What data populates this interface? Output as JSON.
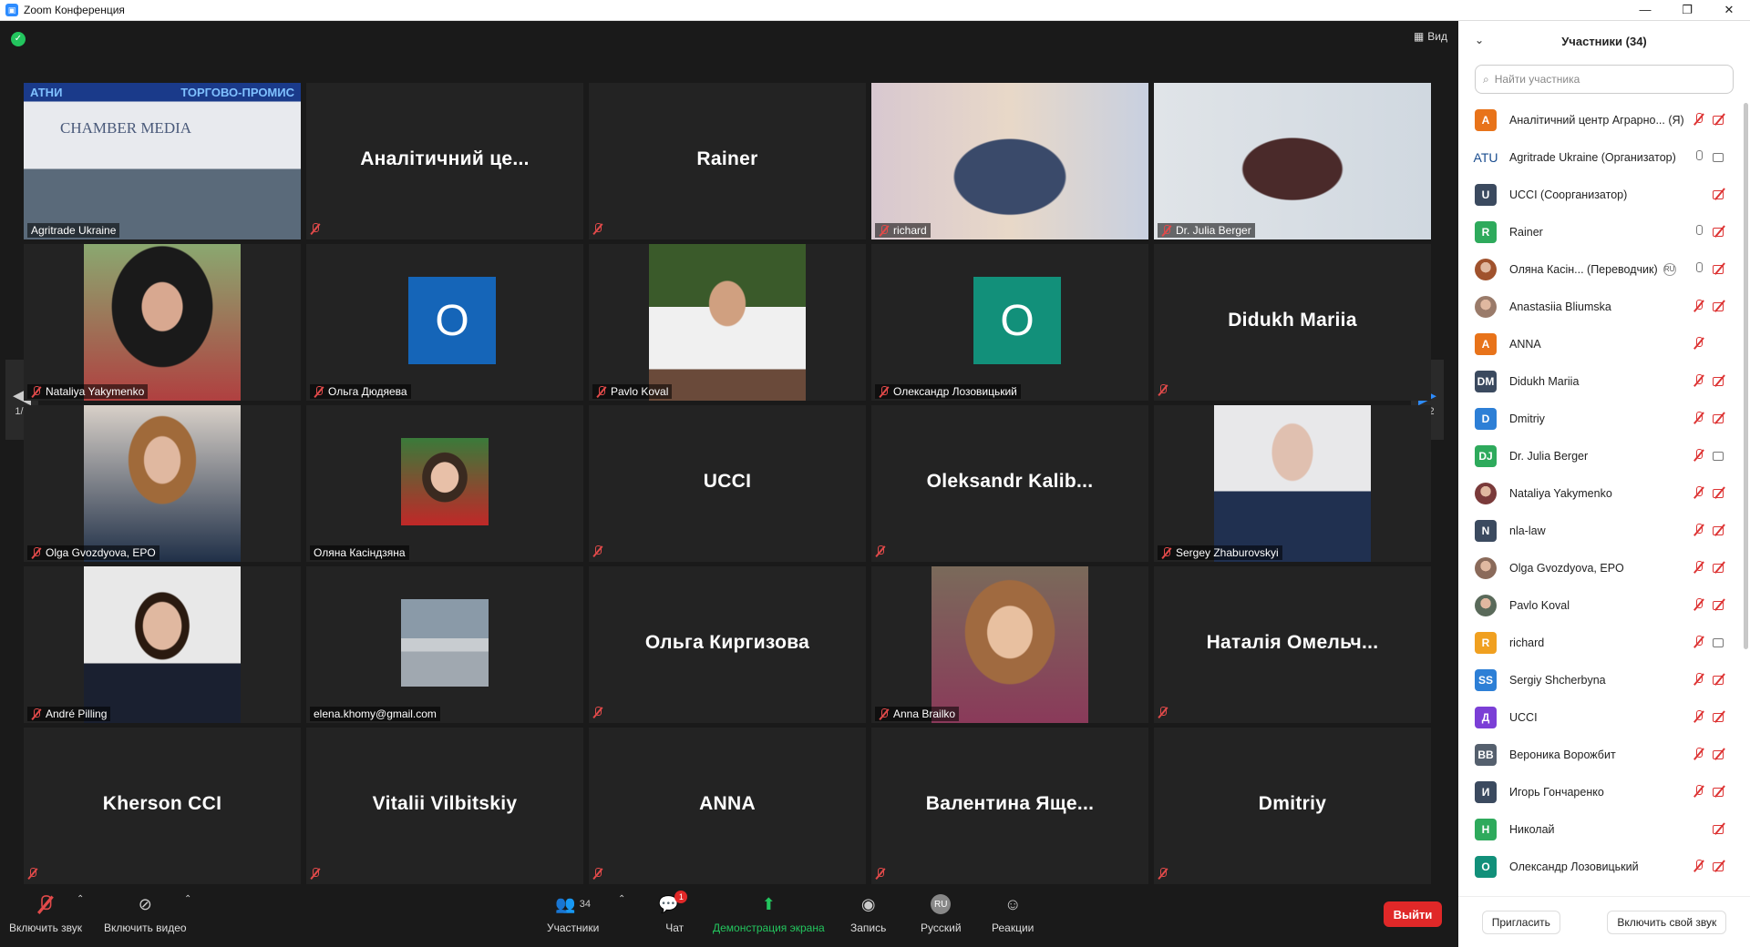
{
  "window": {
    "title": "Zoom Конференция"
  },
  "view": {
    "label": "Вид"
  },
  "tiles": [
    {
      "kind": "photo",
      "label": "Agritrade Ukraine",
      "overlay_text": "ТОРГОВО-ПРОМИС",
      "overlay_text_left": "АТНИ",
      "logo_text": "CHAMBER MEDIA",
      "active": true
    },
    {
      "kind": "name",
      "name": "Аналітичний це..."
    },
    {
      "kind": "name",
      "name": "Rainer"
    },
    {
      "kind": "photo",
      "label": "richard"
    },
    {
      "kind": "photo",
      "label": "Dr. Julia Berger"
    },
    {
      "kind": "photo",
      "label": "Nataliya Yakymenko"
    },
    {
      "kind": "avatar",
      "initial": "О",
      "label": "Ольга Дюдяева",
      "color": "#1565b8"
    },
    {
      "kind": "photo",
      "label": "Pavlo Koval"
    },
    {
      "kind": "avatar",
      "initial": "О",
      "label": "Олександр Лозовицький",
      "color": "#12907a"
    },
    {
      "kind": "name",
      "name": "Didukh Mariia"
    },
    {
      "kind": "photo",
      "label": "Olga Gvozdyova, EPO"
    },
    {
      "kind": "photo",
      "label": "Оляна Касіндзяна"
    },
    {
      "kind": "name",
      "name": "UCCI"
    },
    {
      "kind": "name",
      "name": "Oleksandr Kalib..."
    },
    {
      "kind": "photo",
      "label": "Sergey Zhaburovskyi"
    },
    {
      "kind": "photo",
      "label": "André Pilling"
    },
    {
      "kind": "photo",
      "label": "elena.khomy@gmail.com"
    },
    {
      "kind": "name",
      "name": "Ольга Киргизова"
    },
    {
      "kind": "photo",
      "label": "Anna Brailko"
    },
    {
      "kind": "name",
      "name": "Наталія Омельч..."
    },
    {
      "kind": "name",
      "name": "Kherson CCI"
    },
    {
      "kind": "name",
      "name": "Vitalii Vilbitskiy"
    },
    {
      "kind": "name",
      "name": "ANNA"
    },
    {
      "kind": "name",
      "name": "Валентина Яще..."
    },
    {
      "kind": "name",
      "name": "Dmitriy"
    }
  ],
  "pager": {
    "left": "1/2",
    "right": "1/2"
  },
  "toolbar": {
    "audio": "Включить звук",
    "video": "Включить видео",
    "participants": "Участники",
    "participants_count": "34",
    "chat": "Чат",
    "chat_badge": "1",
    "share": "Демонстрация экрана",
    "record": "Запись",
    "language": "Русский",
    "language_code": "RU",
    "reactions": "Реакции",
    "leave": "Выйти"
  },
  "panel": {
    "title": "Участники (34)",
    "search_placeholder": "Найти участника",
    "invite": "Пригласить",
    "unmute_self": "Включить свой звук",
    "participants": [
      {
        "name": "Аналітичний центр Аграрно... (Я)",
        "avatar": "A",
        "color": "#e8731a",
        "mic": "off",
        "cam": "off"
      },
      {
        "name": "Agritrade Ukraine (Организатор)",
        "avatar": "ATU",
        "color": "#ffffff",
        "text_color": "#1a4d8f",
        "mic": "on",
        "cam": "on"
      },
      {
        "name": "UCCI (Соорганизатор)",
        "avatar": "U",
        "color": "#3b4a5f",
        "mic": "none",
        "cam": "off"
      },
      {
        "name": "Rainer",
        "avatar": "R",
        "color": "#2eaa5c",
        "mic": "on",
        "cam": "off"
      },
      {
        "name": "Оляна Касін... (Переводчик)",
        "avatar": "",
        "color": "#a0522d",
        "mic": "on",
        "cam": "off",
        "badge": "RU"
      },
      {
        "name": "Anastasiia Bliumska",
        "avatar": "",
        "color": "#9a7b6a",
        "mic": "off",
        "cam": "off"
      },
      {
        "name": "ANNA",
        "avatar": "A",
        "color": "#e8731a",
        "mic": "off",
        "cam": "none"
      },
      {
        "name": "Didukh Mariia",
        "avatar": "DM",
        "color": "#3b4a5f",
        "mic": "off",
        "cam": "off"
      },
      {
        "name": "Dmitriy",
        "avatar": "D",
        "color": "#2d7fd6",
        "mic": "off",
        "cam": "off"
      },
      {
        "name": "Dr. Julia Berger",
        "avatar": "DJ",
        "color": "#2eaa5c",
        "mic": "off",
        "cam": "on"
      },
      {
        "name": "Nataliya Yakymenko",
        "avatar": "",
        "color": "#7a3a3a",
        "mic": "off",
        "cam": "off"
      },
      {
        "name": "nla-law",
        "avatar": "N",
        "color": "#3b4a5f",
        "mic": "off",
        "cam": "off"
      },
      {
        "name": "Olga Gvozdyova, EPO",
        "avatar": "",
        "color": "#8a6a5a",
        "mic": "off",
        "cam": "off"
      },
      {
        "name": "Pavlo Koval",
        "avatar": "",
        "color": "#5a6a5a",
        "mic": "off",
        "cam": "off"
      },
      {
        "name": "richard",
        "avatar": "R",
        "color": "#f0a020",
        "mic": "off",
        "cam": "on"
      },
      {
        "name": "Sergiy Shcherbyna",
        "avatar": "SS",
        "color": "#2d7fd6",
        "mic": "off",
        "cam": "off"
      },
      {
        "name": "UCCI",
        "avatar": "Д",
        "color": "#7b3fd6",
        "mic": "off",
        "cam": "off"
      },
      {
        "name": "Вероника Ворожбит",
        "avatar": "ВВ",
        "color": "#55606e",
        "mic": "off",
        "cam": "off"
      },
      {
        "name": "Игорь Гончаренко",
        "avatar": "И",
        "color": "#3b4a5f",
        "mic": "off",
        "cam": "off"
      },
      {
        "name": "Николай",
        "avatar": "Н",
        "color": "#2eaa5c",
        "mic": "none",
        "cam": "off"
      },
      {
        "name": "Олександр Лозовицький",
        "avatar": "О",
        "color": "#12907a",
        "mic": "off",
        "cam": "off"
      }
    ]
  }
}
